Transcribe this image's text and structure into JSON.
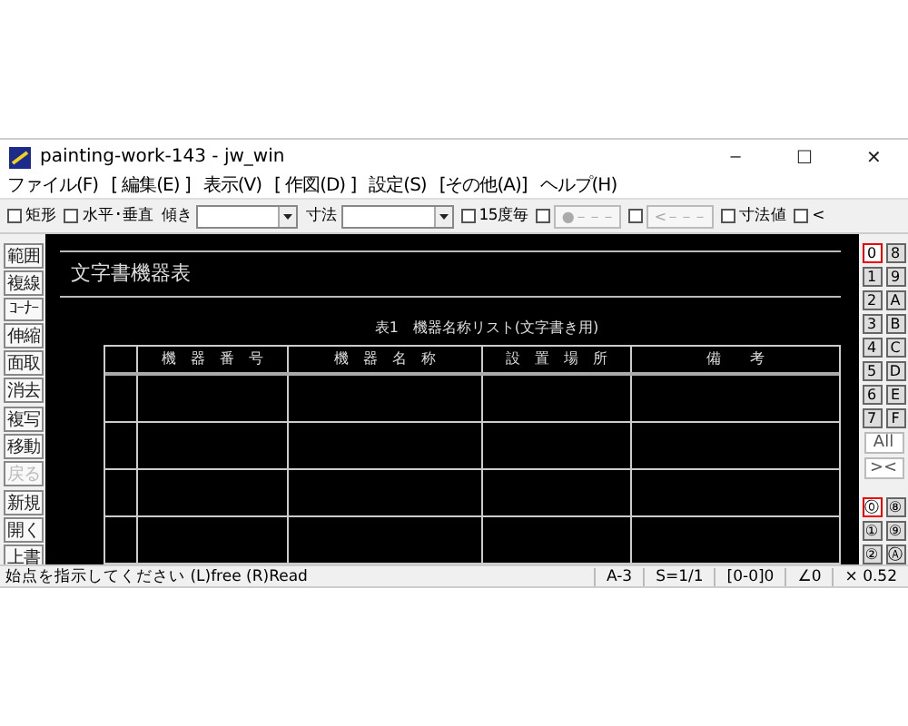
{
  "window": {
    "title": "painting-work-143 - jw_win",
    "controls": [
      "–",
      "☐",
      "✕"
    ]
  },
  "menu": [
    "ファイル(F)",
    "[ 編集(E) ]",
    "表示(V)",
    "[ 作図(D) ]",
    "設定(S)",
    "[その他(A)]",
    "ヘルプ(H)"
  ],
  "toolbar": [
    {
      "kind": "check",
      "label": "矩形",
      "checked": false
    },
    {
      "kind": "check",
      "label": "水平･垂直",
      "checked": false
    },
    {
      "kind": "select",
      "label": "傾き"
    },
    {
      "kind": "select",
      "label": "寸法"
    },
    {
      "kind": "check",
      "label": "15度毎",
      "checked": false
    },
    {
      "kind": "checkbutton",
      "label": "●－－－",
      "checked": false
    },
    {
      "kind": "checkbutton",
      "label": "<－－－",
      "checked": false
    },
    {
      "kind": "check",
      "label": "寸法値",
      "checked": false
    },
    {
      "kind": "check",
      "label": "<",
      "checked": false
    }
  ],
  "left_tools": [
    {
      "label": "範囲",
      "disabled": false
    },
    {
      "label": "複線",
      "disabled": false
    },
    {
      "label": "ｺｰﾅｰ",
      "disabled": false
    },
    {
      "label": "伸縮",
      "disabled": false
    },
    {
      "label": "面取",
      "disabled": false
    },
    {
      "label": "消去",
      "disabled": false
    },
    {
      "label": "複写",
      "disabled": false
    },
    {
      "label": "移動",
      "disabled": false
    },
    {
      "label": "戻る",
      "disabled": true
    },
    {
      "label": "新規",
      "disabled": false
    },
    {
      "label": "開く",
      "disabled": false
    },
    {
      "label": "上書",
      "disabled": false
    }
  ],
  "layers": [
    {
      "label": "0",
      "selected": true
    },
    {
      "label": "8",
      "selected": false
    },
    {
      "label": "1",
      "selected": false
    },
    {
      "label": "9",
      "selected": false
    },
    {
      "label": "2",
      "selected": false
    },
    {
      "label": "A",
      "selected": false
    },
    {
      "label": "3",
      "selected": false
    },
    {
      "label": "B",
      "selected": false
    },
    {
      "label": "4",
      "selected": false
    },
    {
      "label": "C",
      "selected": false
    },
    {
      "label": "5",
      "selected": false
    },
    {
      "label": "D",
      "selected": false
    },
    {
      "label": "6",
      "selected": false
    },
    {
      "label": "E",
      "selected": false
    },
    {
      "label": "7",
      "selected": false
    },
    {
      "label": "F",
      "selected": false
    }
  ],
  "layer_all": "All",
  "layer_invert": "><",
  "layer_groups": [
    {
      "label": "⓪",
      "selected": true
    },
    {
      "label": "⑧",
      "selected": false
    },
    {
      "label": "①",
      "selected": false
    },
    {
      "label": "⑨",
      "selected": false
    },
    {
      "label": "②",
      "selected": false
    },
    {
      "label": "Ⓐ",
      "selected": false
    }
  ],
  "drawing": {
    "title": "文字書機器表",
    "caption": "表1　機器名称リスト(文字書き用)",
    "columns": [
      "",
      "機　器　番　号",
      "機　器　名　称",
      "設　置　場　所",
      "備　　考"
    ]
  },
  "status_bar": {
    "message": "始点を指示してください (L)free (R)Read",
    "fields": [
      "A-3",
      "S=1/1",
      "[0-0]0",
      "∠0",
      "× 0.52"
    ]
  }
}
